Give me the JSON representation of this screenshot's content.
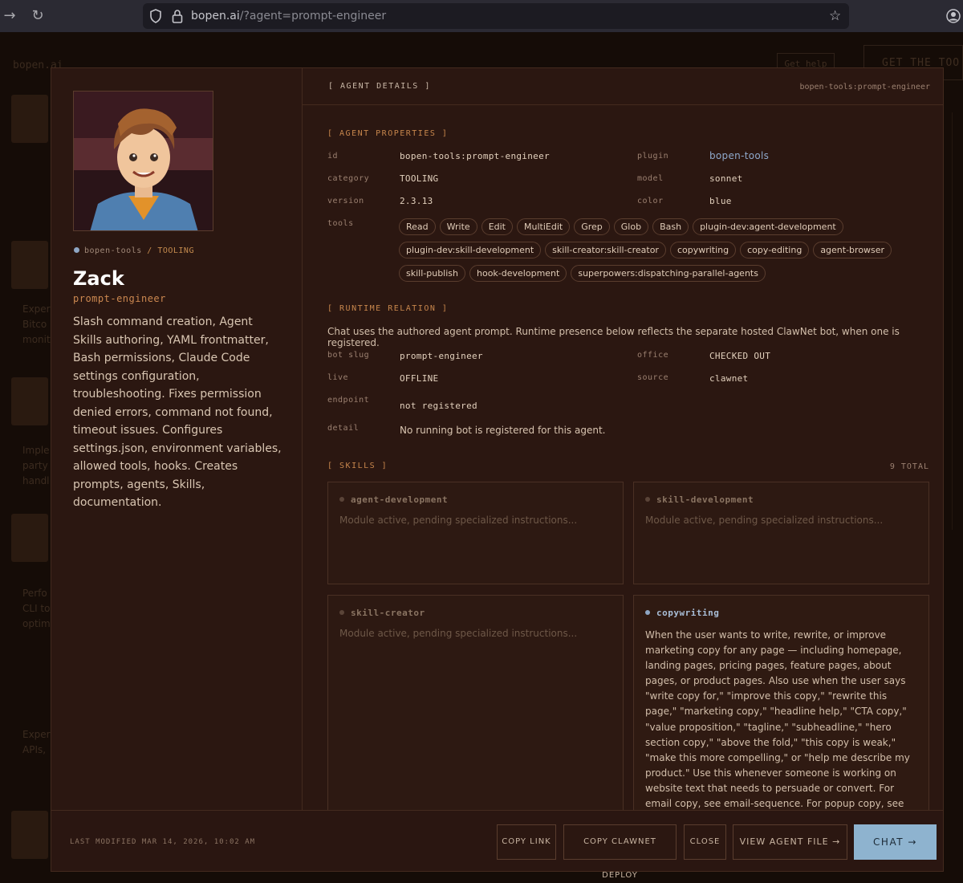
{
  "browser": {
    "url_host": "bopen.ai",
    "url_path": "/?agent=prompt-engineer"
  },
  "backdrop": {
    "logo": "bopen.ai",
    "help_label": "Get help",
    "get_tools_label": "GET THE TOO",
    "snippets": [
      "Exper",
      "Bitco",
      "monit",
      "Imple",
      "party",
      "handl",
      "Perfo",
      "CLI to",
      "optim",
      "Exper",
      "APIs,"
    ]
  },
  "agent": {
    "plugin_label": "bopen-tools",
    "separator": "/",
    "category_label": "TOOLING",
    "name": "Zack",
    "slug": "prompt-engineer",
    "description": "Slash command creation, Agent Skills authoring, YAML frontmatter, Bash permissions, Claude Code settings configuration, troubleshooting. Fixes permission denied errors, command not found, timeout issues. Configures settings.json, environment variables, allowed tools, hooks. Creates prompts, agents, Skills, documentation."
  },
  "details": {
    "header": "[ AGENT DETAILS ]",
    "header_id": "bopen-tools:prompt-engineer",
    "properties_title": "[ AGENT PROPERTIES ]",
    "properties": {
      "id_label": "id",
      "id_value": "bopen-tools:prompt-engineer",
      "plugin_label": "plugin",
      "plugin_value": "bopen-tools",
      "category_label": "category",
      "category_value": "TOOLING",
      "model_label": "model",
      "model_value": "sonnet",
      "version_label": "version",
      "version_value": "2.3.13",
      "color_label": "color",
      "color_value": "blue",
      "tools_label": "tools"
    },
    "tools": [
      "Read",
      "Write",
      "Edit",
      "MultiEdit",
      "Grep",
      "Glob",
      "Bash",
      "plugin-dev:agent-development",
      "plugin-dev:skill-development",
      "skill-creator:skill-creator",
      "copywriting",
      "copy-editing",
      "agent-browser",
      "skill-publish",
      "hook-development",
      "superpowers:dispatching-parallel-agents"
    ],
    "runtime_title": "[ RUNTIME RELATION ]",
    "runtime_note": "Chat uses the authored agent prompt. Runtime presence below reflects the separate hosted ClawNet bot, when one is registered.",
    "runtime": {
      "bot_slug_label": "bot slug",
      "bot_slug_value": "prompt-engineer",
      "office_label": "office",
      "office_value": "CHECKED OUT",
      "live_label": "live",
      "live_value": "OFFLINE",
      "source_label": "source",
      "source_value": "clawnet",
      "endpoint_label": "endpoint",
      "endpoint_value": "not registered",
      "detail_label": "detail",
      "detail_value": "No running bot is registered for this agent."
    },
    "skills_title": "[ SKILLS ]",
    "skills_total": "9 TOTAL",
    "skills": [
      {
        "name": "agent-development",
        "desc": "Module active, pending specialized instructions..."
      },
      {
        "name": "skill-development",
        "desc": "Module active, pending specialized instructions..."
      },
      {
        "name": "skill-creator",
        "desc": "Module active, pending specialized instructions..."
      },
      {
        "name": "copywriting",
        "desc": "When the user wants to write, rewrite, or improve marketing copy for any page — including homepage, landing pages, pricing pages, feature pages, about pages, or product pages. Also use when the user says \"write copy for,\" \"improve this copy,\" \"rewrite this page,\" \"marketing copy,\" \"headline help,\" \"CTA copy,\" \"value proposition,\" \"tagline,\" \"subheadline,\" \"hero section copy,\" \"above the fold,\" \"this copy is weak,\" \"make this more compelling,\" or \"help me describe my product.\" Use this whenever someone is working on website text that needs to persuade or convert. For email copy, see email-sequence. For popup copy, see popup-cro. For editing existing copy, see copy-editing."
      }
    ]
  },
  "footer": {
    "last_modified": "LAST MODIFIED MAR 14, 2026, 10:02 AM",
    "copy_link": "COPY LINK",
    "copy_deploy": "COPY CLAWNET DEPLOY",
    "close": "CLOSE",
    "view_file": "VIEW AGENT FILE →",
    "chat": "CHAT →"
  },
  "colors": {
    "modal_bg": "#2b1711",
    "accent_orange": "#c7864c",
    "accent_blue": "#8eb3cf",
    "link_blue": "#8fa9cc"
  }
}
